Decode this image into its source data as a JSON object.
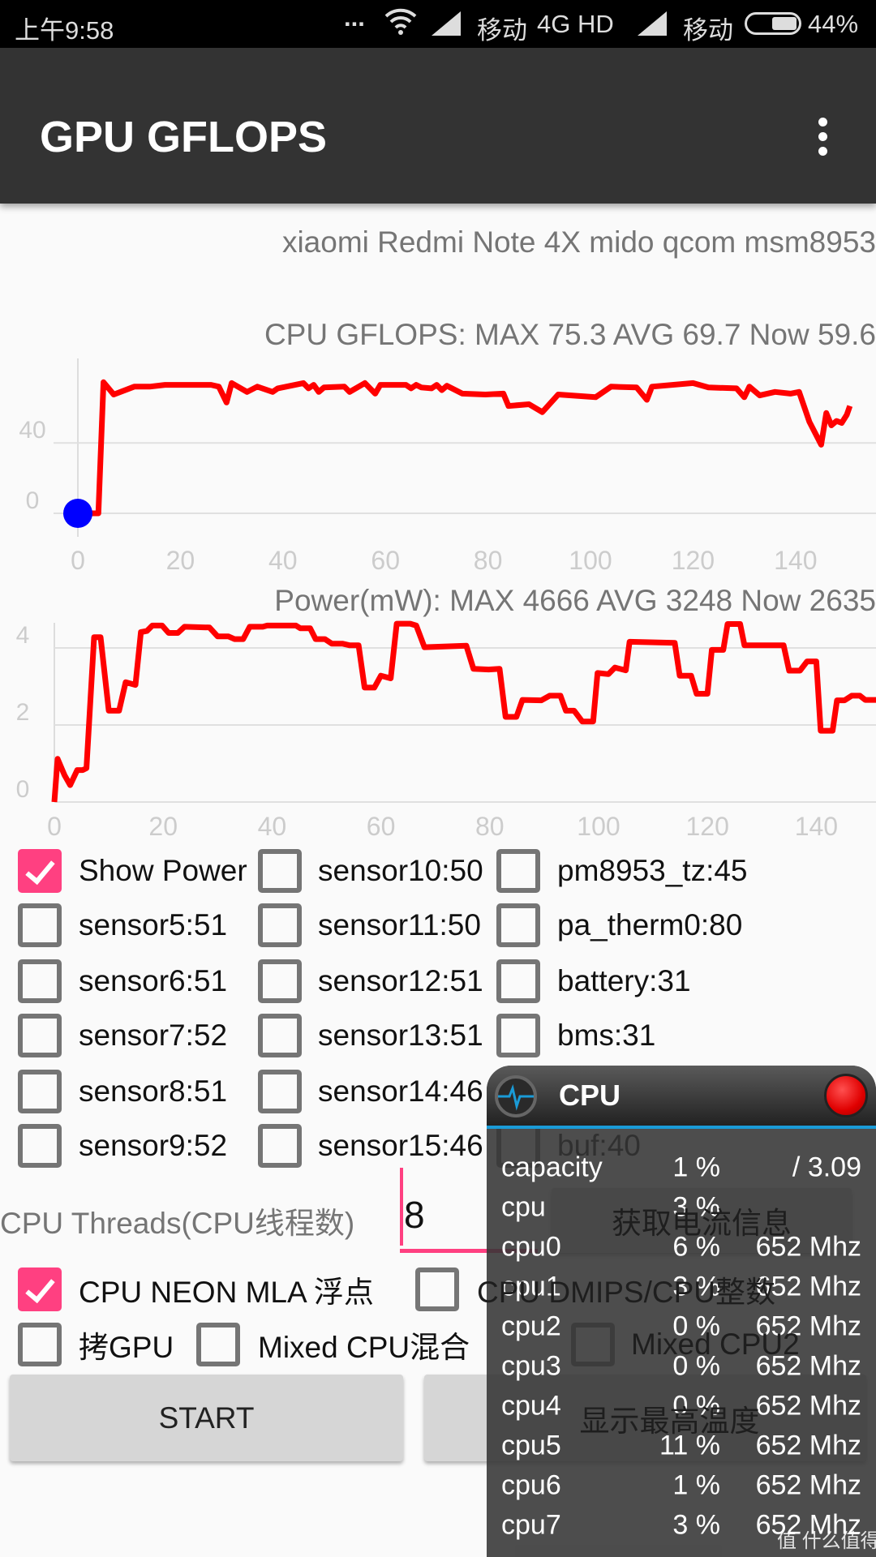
{
  "status_bar": {
    "time": "上午9:58",
    "dots": "...",
    "carrier1": "移动",
    "network": "4G HD",
    "carrier2": "移动",
    "battery": "44%",
    "battery_level": 0.44
  },
  "app_bar": {
    "title": "GPU GFLOPS",
    "menu_icon": "more-vert-icon"
  },
  "device": "xiaomi Redmi Note 4X mido qcom msm8953",
  "colors": {
    "appbar": "#333333",
    "accent": "#ff4081",
    "line": "#ff0000",
    "marker": "#0000ff",
    "overlay_accent": "#1a9bd7"
  },
  "chart_data": [
    {
      "type": "line",
      "title": "CPU GFLOPS: MAX 75.3 AVG 69.7 Now 59.6",
      "xlim": [
        0,
        150
      ],
      "ylim": [
        0,
        75
      ],
      "xticks": [
        "0",
        "20",
        "40",
        "60",
        "80",
        "100",
        "120",
        "140"
      ],
      "yticks": [
        "0",
        "40"
      ],
      "grid": true,
      "marker_point": [
        0,
        0
      ],
      "x": [
        0,
        4,
        5,
        7,
        11,
        14,
        17,
        26,
        27.5,
        29,
        30,
        33,
        35,
        38,
        39,
        44,
        45,
        46,
        47,
        48,
        52,
        53,
        56,
        58,
        59,
        64,
        65,
        66,
        67,
        69,
        70,
        71,
        72,
        75,
        79.5,
        83,
        84,
        88,
        90.6,
        93.7,
        101,
        104,
        109,
        111,
        112,
        120,
        123,
        128.5,
        130,
        131,
        133,
        136,
        139,
        140.7,
        142.7,
        145,
        146,
        147,
        148,
        149,
        150,
        150.6
      ],
      "y": [
        0,
        0,
        74.5,
        67.5,
        72,
        72,
        73,
        73,
        72,
        63,
        74,
        69,
        72,
        69,
        71,
        74,
        71,
        73,
        69,
        71.5,
        72,
        69,
        74,
        68,
        73,
        73,
        71,
        73,
        71.5,
        71,
        73,
        70,
        72.5,
        68,
        67.5,
        68,
        61,
        62,
        57.5,
        67.5,
        66,
        72,
        71.5,
        64.5,
        72,
        74,
        71.5,
        71,
        66,
        72,
        67,
        69,
        68,
        69,
        52,
        39,
        57,
        50,
        52.5,
        51.4,
        56,
        61
      ]
    },
    {
      "type": "line",
      "title": "Power(mW): MAX 4666 AVG 3248 Now 2635",
      "xlim": [
        0,
        151
      ],
      "ylim": [
        0,
        4.7
      ],
      "xticks": [
        "0",
        "20",
        "40",
        "60",
        "80",
        "100",
        "120",
        "140"
      ],
      "yticks": [
        "0",
        "2",
        "4"
      ],
      "grid": true,
      "x": [
        0,
        0.6,
        1.9,
        2.9,
        4.2,
        5.2,
        5.9,
        7.3,
        8.5,
        10,
        11.9,
        13.1,
        14.9,
        15.9,
        17,
        18,
        19.8,
        21,
        22.7,
        23.9,
        28.5,
        30,
        32,
        33.1,
        34.7,
        35.9,
        38.3,
        39.1,
        44.4,
        45.2,
        47,
        48,
        49.7,
        51,
        53,
        54.2,
        55.9,
        57,
        58.8,
        60,
        61.8,
        62.9,
        65.4,
        66.5,
        68,
        75.7,
        77,
        79.8,
        81.8,
        82.9,
        84.9,
        86,
        89.5,
        91,
        93,
        94,
        95.5,
        97,
        99,
        99.8,
        101.8,
        103,
        105,
        105.7,
        114,
        114.9,
        117,
        118,
        120,
        120.8,
        122.9,
        123.7,
        126,
        126.8,
        134,
        135,
        137,
        138.3,
        140,
        140.8,
        143,
        143.8,
        145.2,
        146.5,
        148,
        149,
        151
      ],
      "y": [
        0,
        1.12,
        0.69,
        0.44,
        0.83,
        0.83,
        0.88,
        4.28,
        4.28,
        2.37,
        2.37,
        3.11,
        3.04,
        4.41,
        4.44,
        4.58,
        4.58,
        4.39,
        4.39,
        4.55,
        4.53,
        4.3,
        4.3,
        4.23,
        4.23,
        4.55,
        4.55,
        4.58,
        4.58,
        4.51,
        4.51,
        4.23,
        4.23,
        4.11,
        4.11,
        4.07,
        4.07,
        2.97,
        2.97,
        3.28,
        3.21,
        4.63,
        4.63,
        4.58,
        4.02,
        4.06,
        3.46,
        3.44,
        3.46,
        2.21,
        2.21,
        2.65,
        2.64,
        2.76,
        2.76,
        2.37,
        2.37,
        2.09,
        2.09,
        3.35,
        3.32,
        3.49,
        3.42,
        4.16,
        4.13,
        3.28,
        3.28,
        2.81,
        2.81,
        3.95,
        3.95,
        4.62,
        4.62,
        4.07,
        4.07,
        3.41,
        3.41,
        3.65,
        3.65,
        1.85,
        1.85,
        2.64,
        2.64,
        2.76,
        2.76,
        2.65,
        2.65
      ]
    }
  ],
  "sensors": [
    {
      "label": "Show Power",
      "checked": true
    },
    {
      "label": "sensor10:50",
      "checked": false
    },
    {
      "label": "pm8953_tz:45",
      "checked": false
    },
    {
      "label": "sensor5:51",
      "checked": false
    },
    {
      "label": "sensor11:50",
      "checked": false
    },
    {
      "label": "pa_therm0:80",
      "checked": false
    },
    {
      "label": "sensor6:51",
      "checked": false
    },
    {
      "label": "sensor12:51",
      "checked": false
    },
    {
      "label": "battery:31",
      "checked": false
    },
    {
      "label": "sensor7:52",
      "checked": false
    },
    {
      "label": "sensor13:51",
      "checked": false
    },
    {
      "label": "bms:31",
      "checked": false
    },
    {
      "label": "sensor8:51",
      "checked": false
    },
    {
      "label": "sensor14:46",
      "checked": false
    },
    {
      "label": "",
      "checked": false
    },
    {
      "label": "sensor9:52",
      "checked": false
    },
    {
      "label": "sensor15:46",
      "checked": false
    },
    {
      "label": "buf:40",
      "checked": false
    }
  ],
  "threads": {
    "label": "CPU Threads(CPU线程数)",
    "value": "8"
  },
  "get_current_button": "获取电流信息",
  "modes": {
    "neon": {
      "label": "CPU NEON MLA 浮点",
      "checked": true
    },
    "dmips": {
      "label": "CPU DMIPS/CPU整数",
      "checked": false
    },
    "gpu": {
      "label": "拷GPU",
      "checked": false
    },
    "mixed": {
      "label": "Mixed CPU混合",
      "checked": false
    },
    "mixed2": {
      "label": "Mixed CPU2",
      "checked": false
    }
  },
  "start_button": "START",
  "max_temp_button": "显示最高温度",
  "overlay": {
    "title": "CPU",
    "rows": [
      {
        "name": "capacity",
        "pct": "1 %",
        "value": "/ 3.09"
      },
      {
        "name": "cpu",
        "pct": "3 %",
        "value": ""
      },
      {
        "name": "cpu0",
        "pct": "6 %",
        "value": "652 Mhz"
      },
      {
        "name": "cpu1",
        "pct": "3 %",
        "value": "652 Mhz"
      },
      {
        "name": "cpu2",
        "pct": "0 %",
        "value": "652 Mhz"
      },
      {
        "name": "cpu3",
        "pct": "0 %",
        "value": "652 Mhz"
      },
      {
        "name": "cpu4",
        "pct": "0 %",
        "value": "652 Mhz"
      },
      {
        "name": "cpu5",
        "pct": "11 %",
        "value": "652 Mhz"
      },
      {
        "name": "cpu6",
        "pct": "1 %",
        "value": "652 Mhz"
      },
      {
        "name": "cpu7",
        "pct": "3 %",
        "value": "652 Mhz"
      }
    ]
  },
  "watermark": "值 什么值得买"
}
